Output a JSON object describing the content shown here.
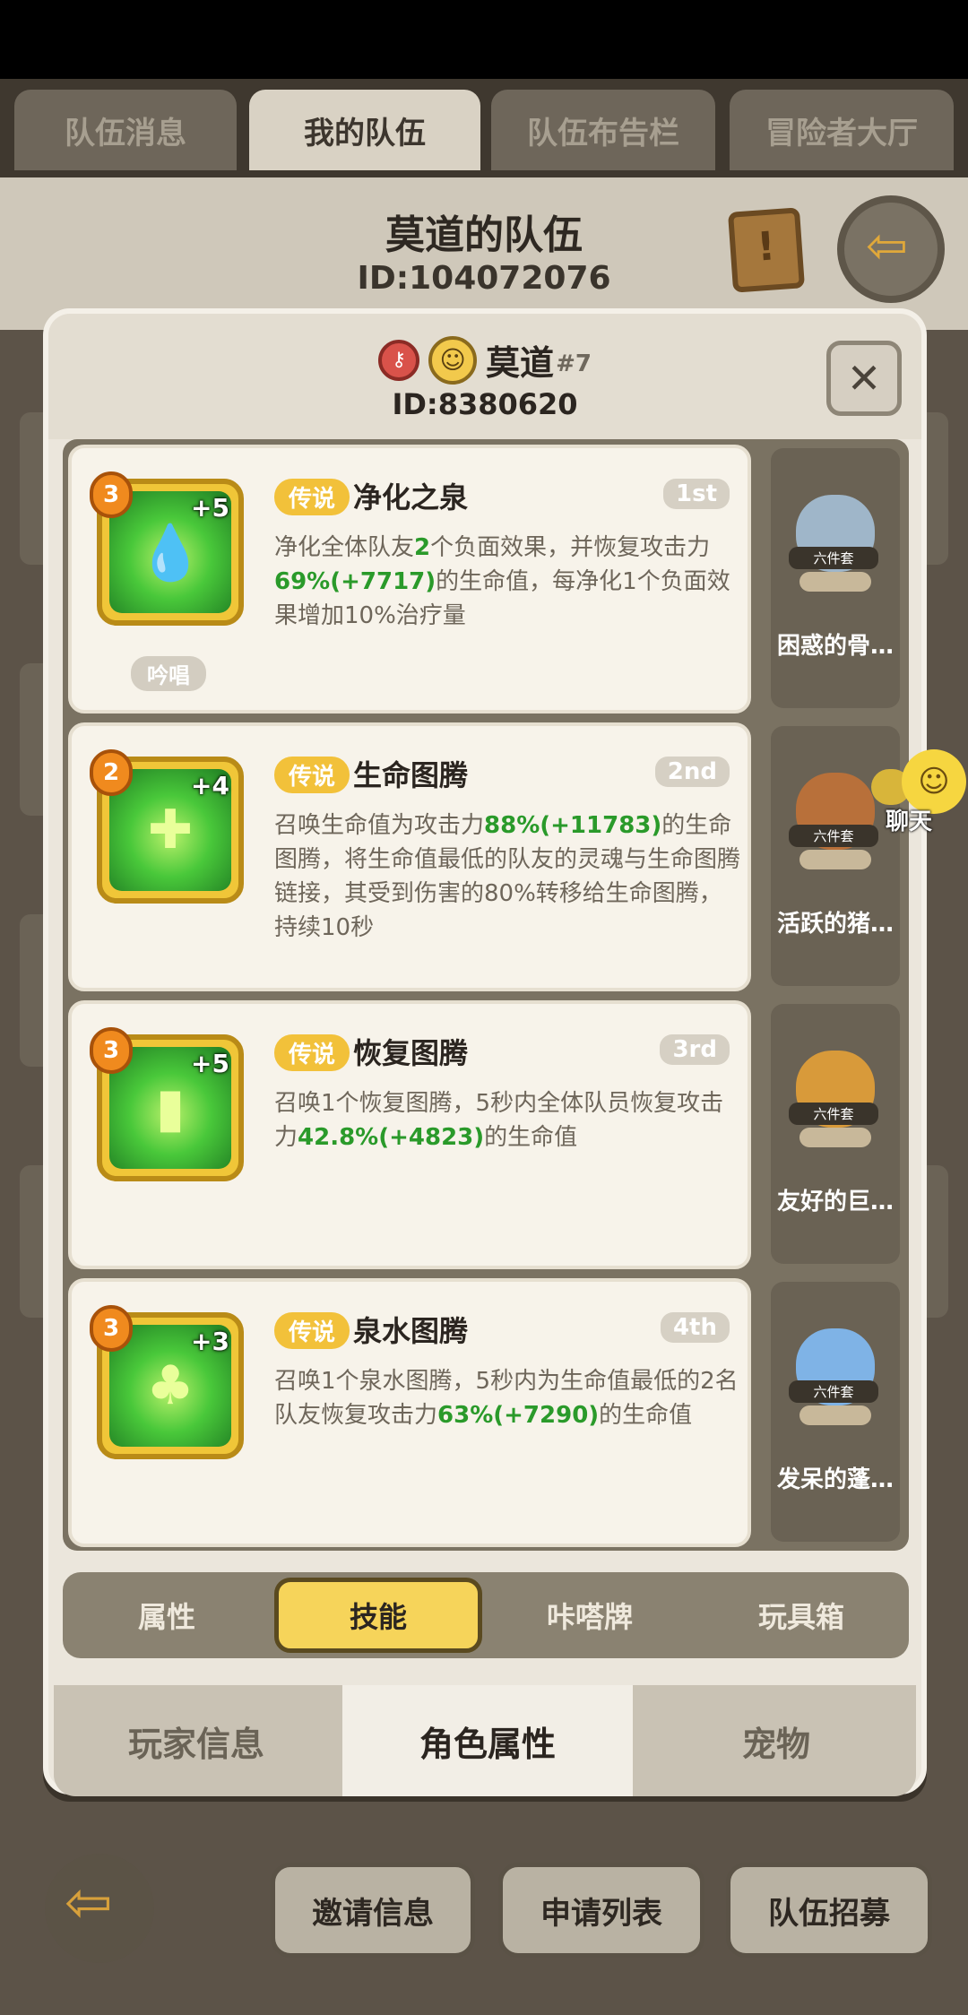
{
  "top_tabs": [
    "队伍消息",
    "我的队伍",
    "队伍布告栏",
    "冒险者大厅"
  ],
  "team": {
    "name": "莫道的队伍",
    "id": "ID:104072076"
  },
  "player": {
    "name": "莫道",
    "rank": "#7",
    "id": "ID:8380620"
  },
  "skills": [
    {
      "level": "3",
      "plus": "+5",
      "rarity": "传说",
      "name": "净化之泉",
      "rank": "1st",
      "tag": "吟唱",
      "desc_parts": [
        {
          "t": "净化全体队友",
          "h": false
        },
        {
          "t": "2",
          "h": true
        },
        {
          "t": "个负面效果，并恢复攻击力",
          "h": false
        },
        {
          "t": "69%(+7717)",
          "h": true
        },
        {
          "t": "的生命值，每净化1个负面效果增加10%治疗量",
          "h": false
        }
      ]
    },
    {
      "level": "2",
      "plus": "+4",
      "rarity": "传说",
      "name": "生命图腾",
      "rank": "2nd",
      "tag": "",
      "desc_parts": [
        {
          "t": "召唤生命值为攻击力",
          "h": false
        },
        {
          "t": "88%(+11783)",
          "h": true
        },
        {
          "t": "的生命图腾，将生命值最低的队友的灵魂与生命图腾链接，其受到伤害的80%转移给生命图腾，持续10秒",
          "h": false
        }
      ]
    },
    {
      "level": "3",
      "plus": "+5",
      "rarity": "传说",
      "name": "恢复图腾",
      "rank": "3rd",
      "tag": "",
      "desc_parts": [
        {
          "t": "召唤1个恢复图腾，5秒内全体队员恢复攻击力",
          "h": false
        },
        {
          "t": "42.8%(+4823)",
          "h": true
        },
        {
          "t": "的生命值",
          "h": false
        }
      ]
    },
    {
      "level": "3",
      "plus": "+3",
      "rarity": "传说",
      "name": "泉水图腾",
      "rank": "4th",
      "tag": "",
      "desc_parts": [
        {
          "t": "召唤1个泉水图腾，5秒内为生命值最低的2名队友恢复攻击力",
          "h": false
        },
        {
          "t": "63%(+7290)",
          "h": true
        },
        {
          "t": "的生命值",
          "h": false
        }
      ]
    }
  ],
  "pets": [
    {
      "name": "困惑的骨…",
      "set": "六件套",
      "color": "#9fb6c9"
    },
    {
      "name": "活跃的猪…",
      "set": "六件套",
      "color": "#b8703a"
    },
    {
      "name": "友好的巨…",
      "set": "六件套",
      "color": "#d89a3a"
    },
    {
      "name": "发呆的蓬…",
      "set": "六件套",
      "color": "#7fb3e6"
    }
  ],
  "sub_tabs": [
    "属性",
    "技能",
    "咔嗒牌",
    "玩具箱"
  ],
  "main_tabs": [
    "玩家信息",
    "角色属性",
    "宠物"
  ],
  "bottom_buttons": [
    "邀请信息",
    "申请列表",
    "队伍招募"
  ],
  "chat": {
    "label": "聊天"
  }
}
